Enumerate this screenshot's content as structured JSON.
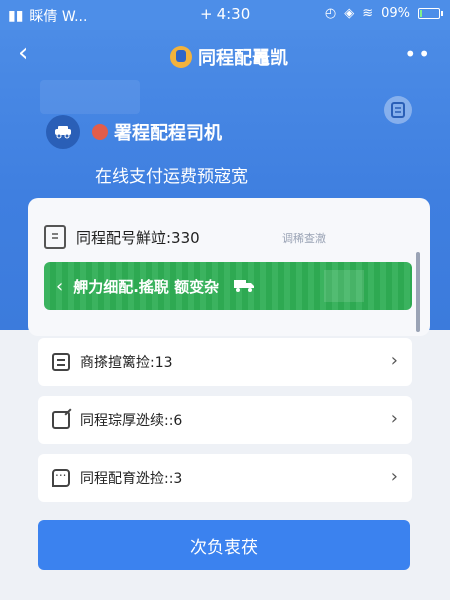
{
  "status_bar": {
    "carrier": "睬倩 W...",
    "time": "4:30",
    "battery": "09%",
    "battery_fraction": 0.09
  },
  "nav": {
    "title": "同程配鼉凯"
  },
  "profile": {
    "name": "署程配程司机",
    "subtitle": "在线支付运费预宼宽"
  },
  "card": {
    "order_count": "同程配号鮮竝:330",
    "faint_label": "调稀查澈",
    "banner_text": "舺力细配.搖聣 额变杂"
  },
  "list": [
    {
      "label": "商搽揎篱捡:13",
      "icon": "doc"
    },
    {
      "label": "同程琮厚迯续::6",
      "icon": "edit"
    },
    {
      "label": "同程配育迯捡::3",
      "icon": "chat"
    }
  ],
  "primary_button": {
    "label": "次负衷茯"
  },
  "colors": {
    "header_blue": "#4c8ce6",
    "banner_green": "#2fae55",
    "button_blue": "#3b82ef"
  }
}
